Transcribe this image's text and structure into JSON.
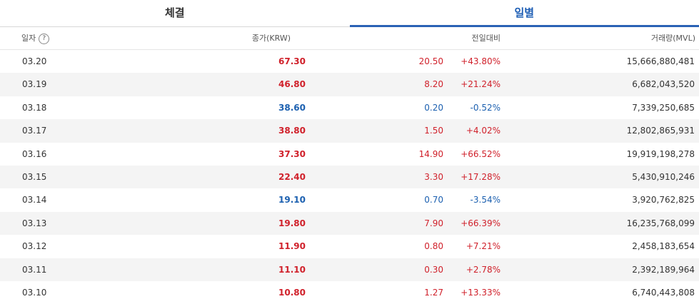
{
  "tabs": [
    {
      "label": "체결",
      "active": false
    },
    {
      "label": "일별",
      "active": true
    }
  ],
  "header": {
    "date": "일자",
    "help": "?",
    "close": "종가(KRW)",
    "change": "전일대비",
    "volume": "거래량(MVL)"
  },
  "colors": {
    "up": "#d0212b",
    "down": "#1c60b0",
    "accent": "#2a62b5"
  },
  "rows": [
    {
      "date": "03.20",
      "close": "67.30",
      "diff": "20.50",
      "rate": "+43.80%",
      "volume": "15,666,880,481",
      "dir": "up"
    },
    {
      "date": "03.19",
      "close": "46.80",
      "diff": "8.20",
      "rate": "+21.24%",
      "volume": "6,682,043,520",
      "dir": "up"
    },
    {
      "date": "03.18",
      "close": "38.60",
      "diff": "0.20",
      "rate": "-0.52%",
      "volume": "7,339,250,685",
      "dir": "down"
    },
    {
      "date": "03.17",
      "close": "38.80",
      "diff": "1.50",
      "rate": "+4.02%",
      "volume": "12,802,865,931",
      "dir": "up"
    },
    {
      "date": "03.16",
      "close": "37.30",
      "diff": "14.90",
      "rate": "+66.52%",
      "volume": "19,919,198,278",
      "dir": "up"
    },
    {
      "date": "03.15",
      "close": "22.40",
      "diff": "3.30",
      "rate": "+17.28%",
      "volume": "5,430,910,246",
      "dir": "up"
    },
    {
      "date": "03.14",
      "close": "19.10",
      "diff": "0.70",
      "rate": "-3.54%",
      "volume": "3,920,762,825",
      "dir": "down"
    },
    {
      "date": "03.13",
      "close": "19.80",
      "diff": "7.90",
      "rate": "+66.39%",
      "volume": "16,235,768,099",
      "dir": "up"
    },
    {
      "date": "03.12",
      "close": "11.90",
      "diff": "0.80",
      "rate": "+7.21%",
      "volume": "2,458,183,654",
      "dir": "up"
    },
    {
      "date": "03.11",
      "close": "11.10",
      "diff": "0.30",
      "rate": "+2.78%",
      "volume": "2,392,189,964",
      "dir": "up"
    },
    {
      "date": "03.10",
      "close": "10.80",
      "diff": "1.27",
      "rate": "+13.33%",
      "volume": "6,740,443,808",
      "dir": "up"
    }
  ]
}
